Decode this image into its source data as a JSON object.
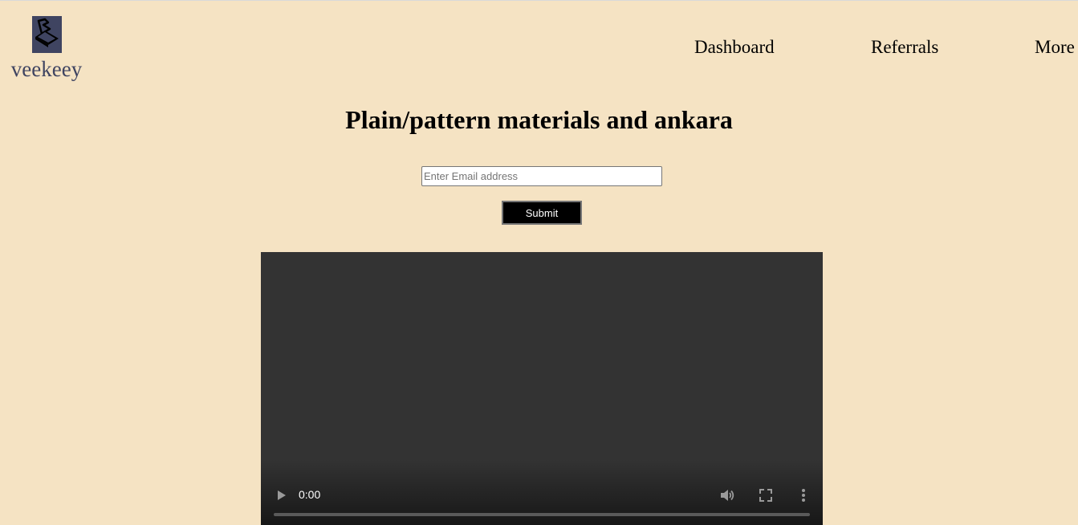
{
  "brand": {
    "name": "veekeey",
    "logo_icon": "hand-fabric-icon"
  },
  "nav": {
    "items": [
      {
        "label": "Dashboard"
      },
      {
        "label": "Referrals"
      },
      {
        "label": "More"
      }
    ]
  },
  "main": {
    "title": "Plain/pattern materials and ankara",
    "email_placeholder": "Enter Email address",
    "email_value": "",
    "submit_label": "Submit"
  },
  "video": {
    "current_time": "0:00",
    "progress": 0,
    "icons": [
      "play-icon",
      "volume-icon",
      "fullscreen-icon",
      "more-vert-icon"
    ]
  },
  "colors": {
    "background": "#f5e3c3",
    "logo_bg": "#3f4461",
    "video_bg": "#333333"
  }
}
